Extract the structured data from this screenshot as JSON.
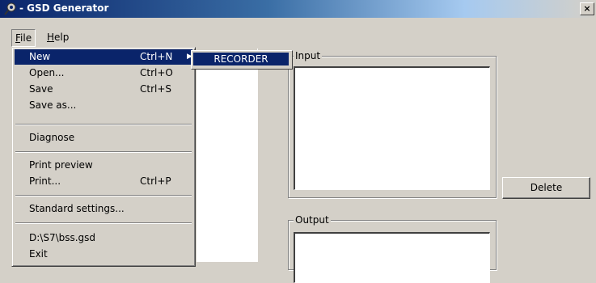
{
  "window": {
    "title": "- GSD Generator",
    "close_label": "×"
  },
  "menubar": {
    "file": {
      "mnemonic": "F",
      "rest": "ile"
    },
    "help": {
      "mnemonic": "H",
      "rest": "elp"
    }
  },
  "file_menu": {
    "items": [
      {
        "label": "New",
        "shortcut": "Ctrl+N",
        "submenu_arrow": "▶"
      },
      {
        "label": "Open...",
        "shortcut": "Ctrl+O"
      },
      {
        "label": "Save",
        "shortcut": "Ctrl+S"
      },
      {
        "label": "Save as..."
      },
      {
        "label": "Diagnose"
      },
      {
        "label": "Print preview"
      },
      {
        "label": "Print...",
        "shortcut": "Ctrl+P"
      },
      {
        "label": "Standard settings..."
      },
      {
        "label": "D:\\S7\\bss.gsd"
      },
      {
        "label": "Exit"
      }
    ]
  },
  "new_submenu": {
    "items": [
      {
        "label": "RECORDER"
      }
    ]
  },
  "input_group": {
    "label": "Input"
  },
  "output_group": {
    "label": "Output"
  },
  "buttons": {
    "delete": "Delete"
  }
}
